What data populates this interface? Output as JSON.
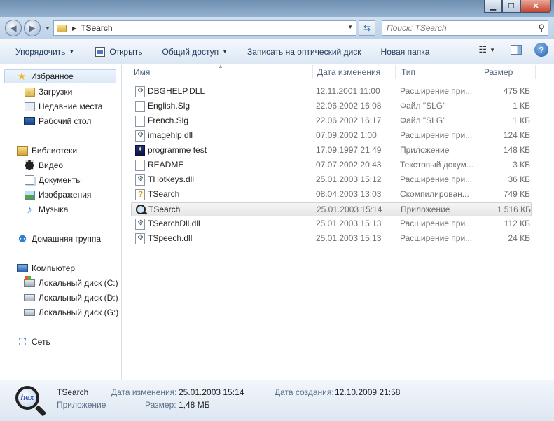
{
  "window": {
    "title": "TSearch",
    "controls": {
      "minimize": "▁",
      "maximize": "☐",
      "close": "✕"
    }
  },
  "address": {
    "path": "TSearch",
    "search_placeholder": "Поиск: TSearch"
  },
  "toolbar": {
    "organize": "Упорядочить",
    "open": "Открыть",
    "share": "Общий доступ",
    "burn": "Записать на оптический диск",
    "new_folder": "Новая папка",
    "help": "?"
  },
  "nav": {
    "favorites": "Избранное",
    "downloads": "Загрузки",
    "recent": "Недавние места",
    "desktop": "Рабочий стол",
    "libraries": "Библиотеки",
    "video": "Видео",
    "documents": "Документы",
    "images": "Изображения",
    "music": "Музыка",
    "homegroup": "Домашняя группа",
    "computer": "Компьютер",
    "drive_c": "Локальный диск (C:)",
    "drive_d": "Локальный диск (D:)",
    "drive_g": "Локальный диск (G:)",
    "network": "Сеть"
  },
  "columns": {
    "name": "Имя",
    "date": "Дата изменения",
    "type": "Тип",
    "size": "Размер"
  },
  "files": [
    {
      "name": "DBGHELP.DLL",
      "date": "12.11.2001 11:00",
      "type": "Расширение при...",
      "size": "475 КБ",
      "icon": "dll-icon"
    },
    {
      "name": "English.Slg",
      "date": "22.06.2002 16:08",
      "type": "Файл \"SLG\"",
      "size": "1 КБ",
      "icon": "file-icon"
    },
    {
      "name": "French.Slg",
      "date": "22.06.2002 16:17",
      "type": "Файл \"SLG\"",
      "size": "1 КБ",
      "icon": "file-icon"
    },
    {
      "name": "imagehlp.dll",
      "date": "07.09.2002 1:00",
      "type": "Расширение при...",
      "size": "124 КБ",
      "icon": "dll-icon"
    },
    {
      "name": "programme test",
      "date": "17.09.1997 21:49",
      "type": "Приложение",
      "size": "148 КБ",
      "icon": "app-icon"
    },
    {
      "name": "README",
      "date": "07.07.2002 20:43",
      "type": "Текстовый докум...",
      "size": "3 КБ",
      "icon": "text-file-icon"
    },
    {
      "name": "THotkeys.dll",
      "date": "25.01.2003 15:12",
      "type": "Расширение при...",
      "size": "36 КБ",
      "icon": "dll-icon"
    },
    {
      "name": "TSearch",
      "date": "08.04.2003 13:03",
      "type": "Скомпилирован...",
      "size": "749 КБ",
      "icon": "help-file-icon"
    },
    {
      "name": "TSearch",
      "date": "25.01.2003 15:14",
      "type": "Приложение",
      "size": "1 516 КБ",
      "icon": "magnifier-icon"
    },
    {
      "name": "TSearchDll.dll",
      "date": "25.01.2003 15:13",
      "type": "Расширение при...",
      "size": "112 КБ",
      "icon": "dll-icon"
    },
    {
      "name": "TSpeech.dll",
      "date": "25.01.2003 15:13",
      "type": "Расширение при...",
      "size": "24 КБ",
      "icon": "dll-icon"
    }
  ],
  "details": {
    "name": "TSearch",
    "type": "Приложение",
    "modified_label": "Дата изменения:",
    "modified_value": "25.01.2003 15:14",
    "size_label": "Размер:",
    "size_value": "1,48 МБ",
    "created_label": "Дата создания:",
    "created_value": "12.10.2009 21:58",
    "icon_text": "hex"
  }
}
